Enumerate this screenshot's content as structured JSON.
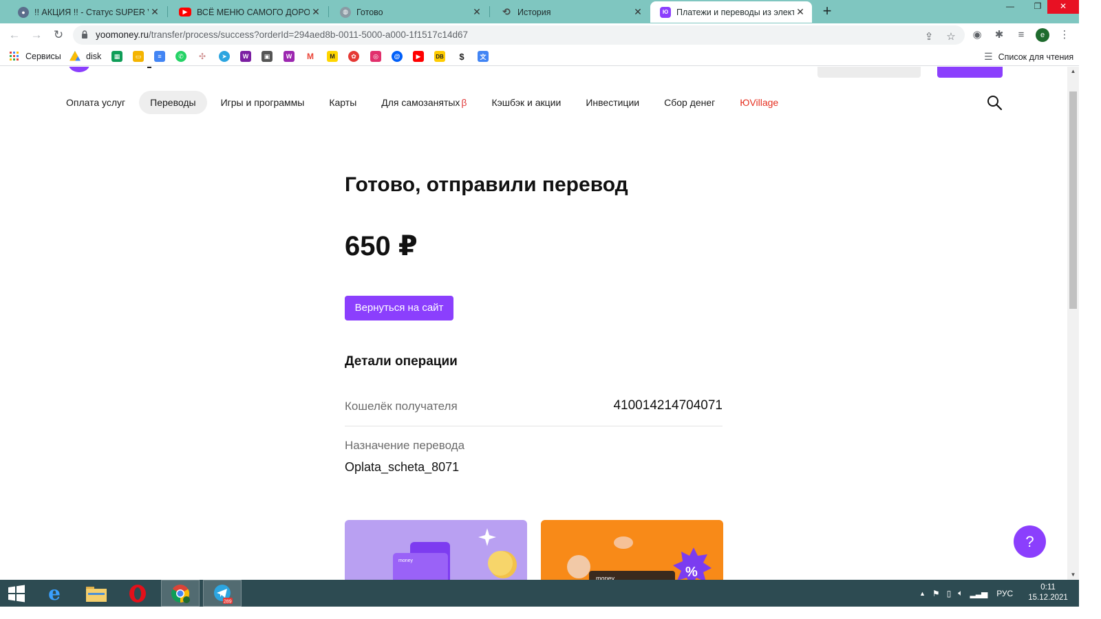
{
  "browser": {
    "tabs": [
      {
        "title": "!! АКЦИЯ !! - Статус SUPER VIP с",
        "active": false
      },
      {
        "title": "ВСЁ МЕНЮ САМОГО ДОРОГОГО",
        "active": false
      },
      {
        "title": "Готово",
        "active": false
      },
      {
        "title": "История",
        "active": false
      },
      {
        "title": "Платежи и переводы из электр",
        "active": true
      }
    ],
    "url_host": "yoomoney.ru",
    "url_path": "/transfer/process/success?orderId=294aed8b-0011-5000-a000-1f1517c14d67",
    "profile_initial": "e",
    "bookmarks": {
      "services": "Сервисы",
      "disk": "disk",
      "reading_list": "Список для чтения"
    }
  },
  "site": {
    "nav": [
      {
        "label": "Оплата услуг",
        "active": false
      },
      {
        "label": "Переводы",
        "active": true
      },
      {
        "label": "Игры и программы",
        "active": false
      },
      {
        "label": "Карты",
        "active": false
      },
      {
        "label": "Для самозанятых",
        "beta": "β",
        "active": false
      },
      {
        "label": "Кэшбэк и акции",
        "active": false
      },
      {
        "label": "Инвестиции",
        "active": false
      },
      {
        "label": "Сбор денег",
        "active": false
      },
      {
        "label": "ЮVillage",
        "active": false
      }
    ],
    "accent_color": "#8b3ffd"
  },
  "result": {
    "title": "Готово, отправили перевод",
    "amount": "650 ₽",
    "back_button": "Вернуться на сайт",
    "details_title": "Детали операции",
    "recipient_label": "Кошелёк получателя",
    "recipient_value": "4100142147040​71",
    "purpose_label": "Назначение перевода",
    "purpose_value": "Oplata_scheta_8071",
    "promo_brand": "money"
  },
  "help_button": "?",
  "taskbar": {
    "telegram_badge": "289",
    "language": "РУС",
    "time": "0:11",
    "date": "15.12.2021"
  }
}
